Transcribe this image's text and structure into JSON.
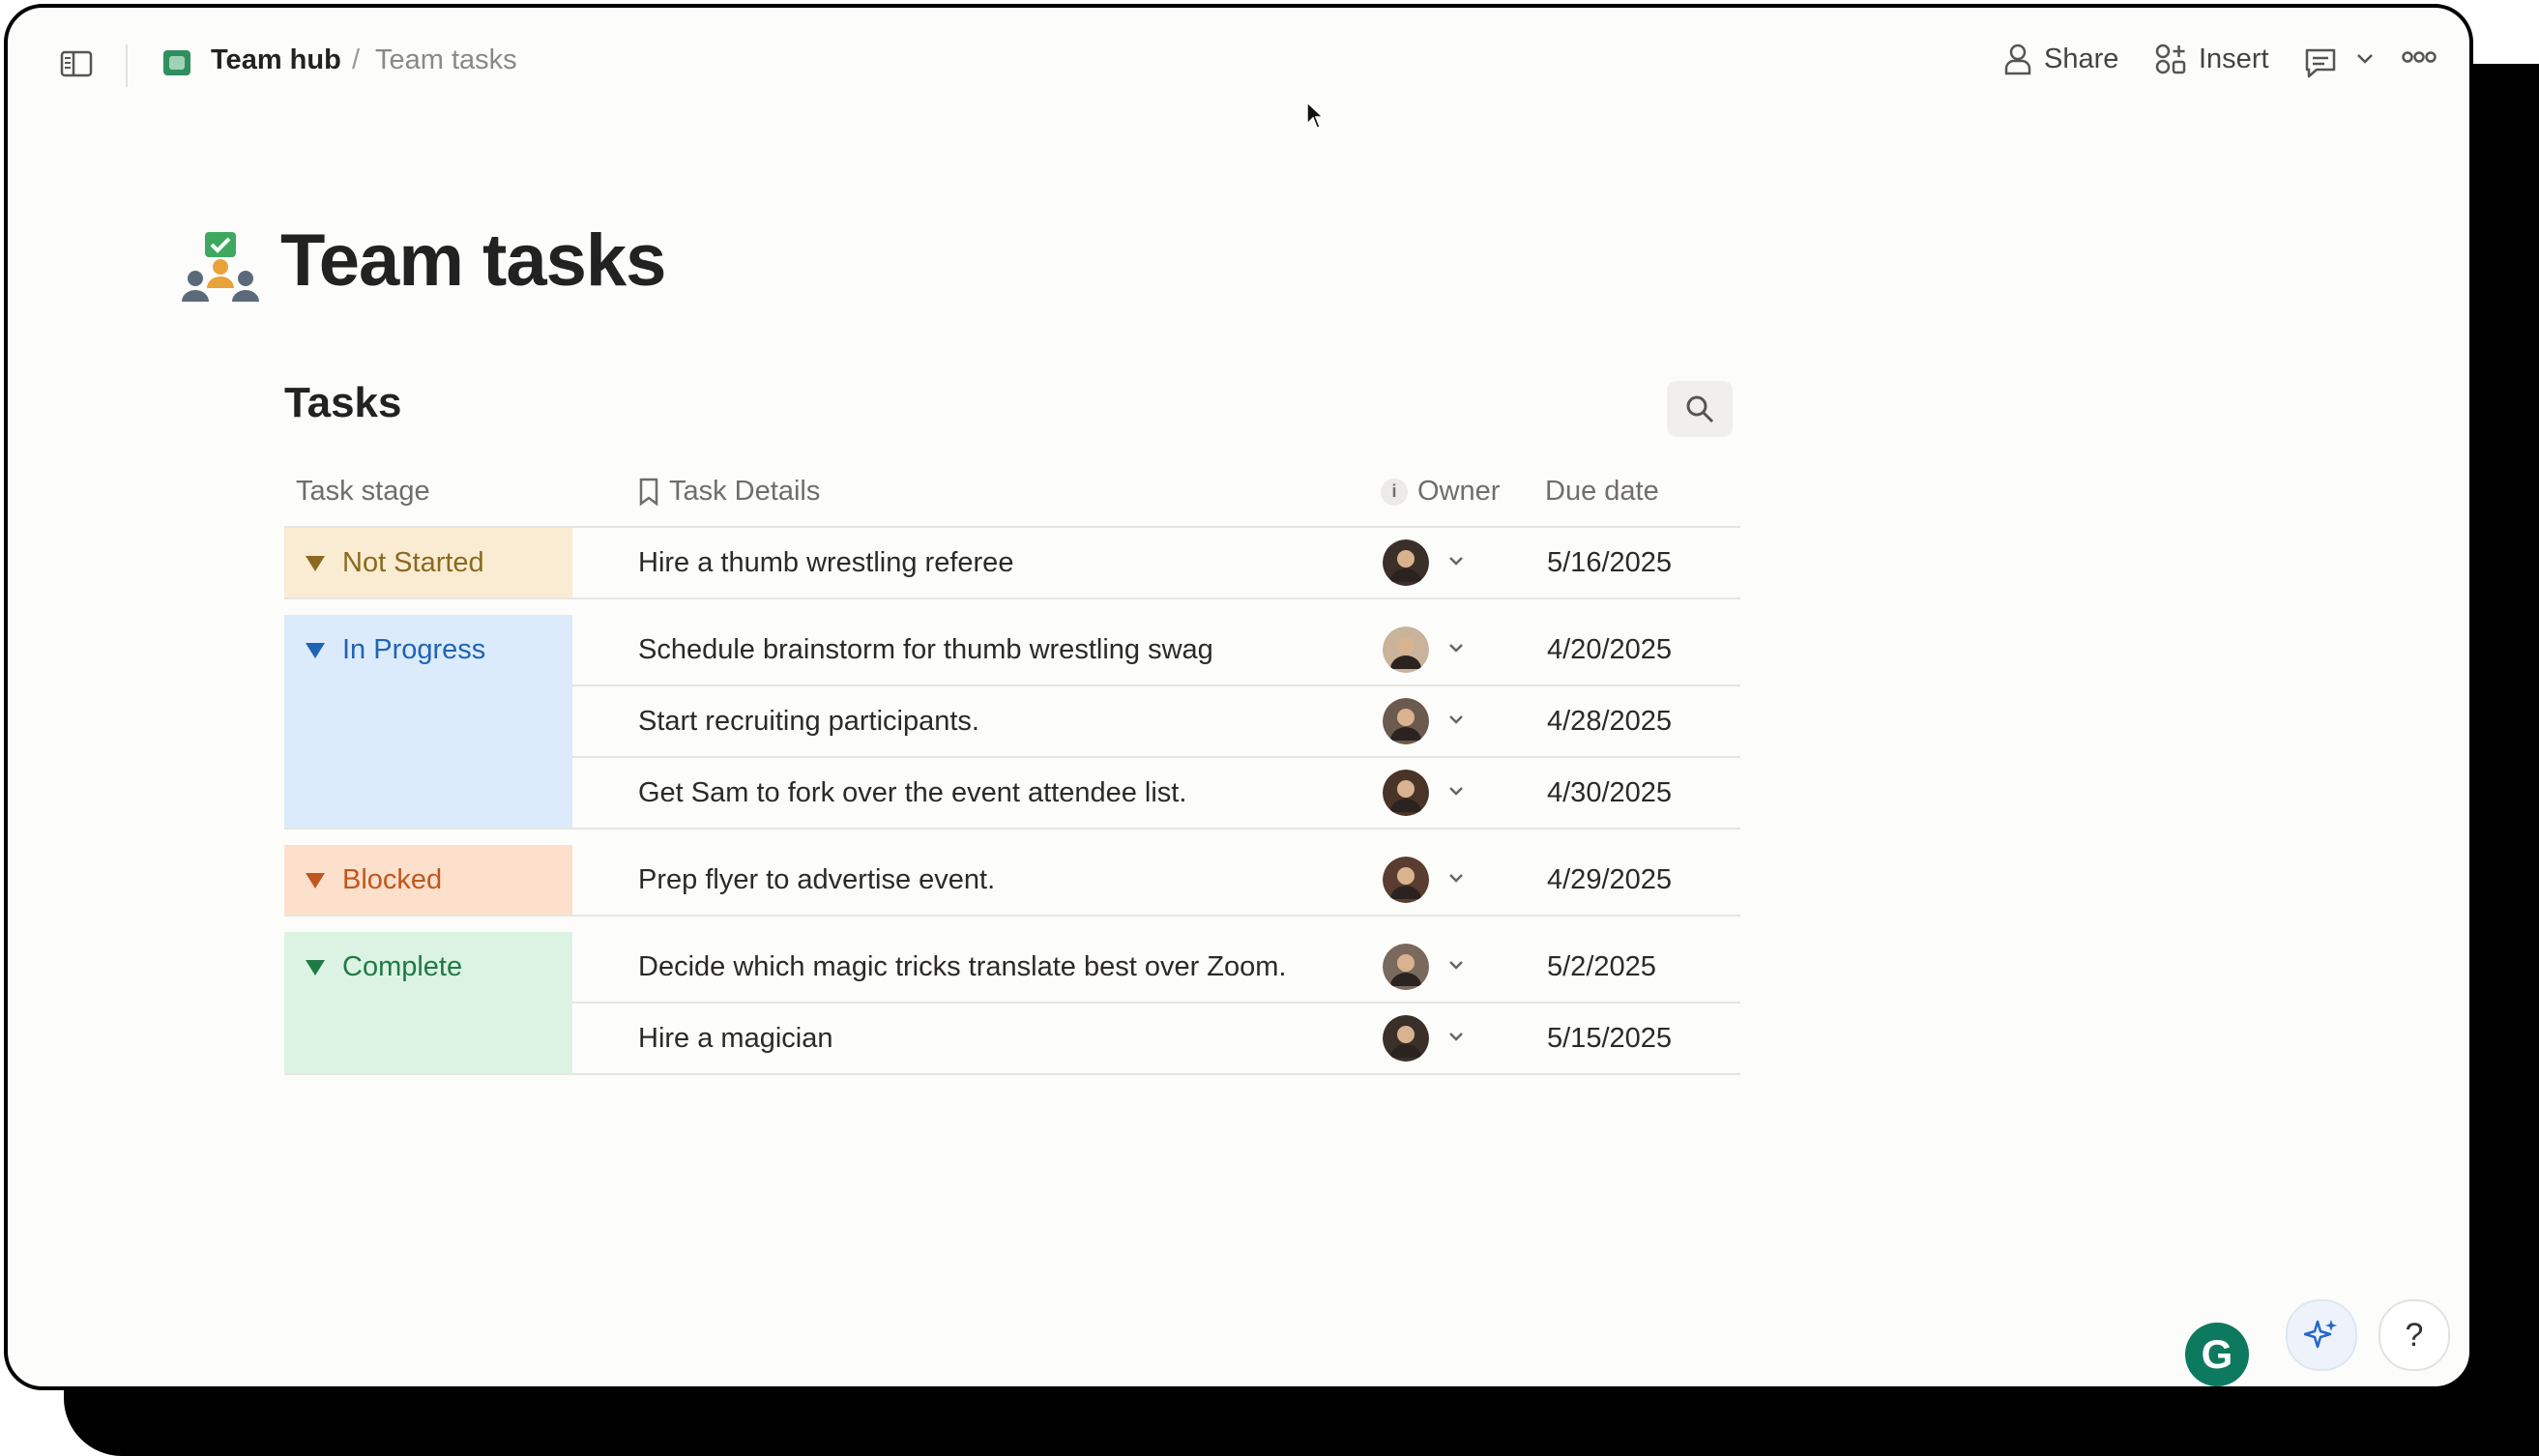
{
  "header": {
    "breadcrumb": {
      "workspace": "Team hub",
      "separator": "/",
      "page": "Team tasks"
    },
    "actions": {
      "share": "Share",
      "insert": "Insert"
    }
  },
  "page": {
    "title": "Team tasks"
  },
  "section": {
    "title": "Tasks"
  },
  "table": {
    "columns": {
      "stage": "Task stage",
      "details": "Task Details",
      "owner_info": "i",
      "owner": "Owner",
      "due": "Due date"
    },
    "groups": [
      {
        "stage": "Not Started",
        "color": "#8a6a1f",
        "bg": "#faecd3",
        "rows": [
          {
            "task": "Hire a thumb wrestling referee",
            "due": "5/16/2025"
          }
        ]
      },
      {
        "stage": "In Progress",
        "color": "#1f63b6",
        "bg": "#dcebfb",
        "rows": [
          {
            "task": "Schedule brainstorm for thumb wrestling swag",
            "due": "4/20/2025"
          },
          {
            "task": "Start recruiting participants.",
            "due": "4/28/2025"
          },
          {
            "task": "Get Sam to fork over the event attendee list.",
            "due": "4/30/2025"
          }
        ]
      },
      {
        "stage": "Blocked",
        "color": "#c0571e",
        "bg": "#fde0cc",
        "rows": [
          {
            "task": "Prep flyer to advertise event.",
            "due": "4/29/2025"
          }
        ]
      },
      {
        "stage": "Complete",
        "color": "#1f7a45",
        "bg": "#dcf3e4",
        "rows": [
          {
            "task": "Decide which magic tricks translate best over Zoom.",
            "due": "5/2/2025"
          },
          {
            "task": "Hire a magician",
            "due": "5/15/2025"
          }
        ]
      }
    ]
  },
  "floating": {
    "grammarly": "G",
    "help": "?"
  },
  "icons": [
    "sidebar-toggle-icon",
    "team-hub-icon",
    "person-icon",
    "insert-icon",
    "comment-icon",
    "chevron-down-icon",
    "more-icon",
    "search-icon",
    "sparkle-icon"
  ]
}
